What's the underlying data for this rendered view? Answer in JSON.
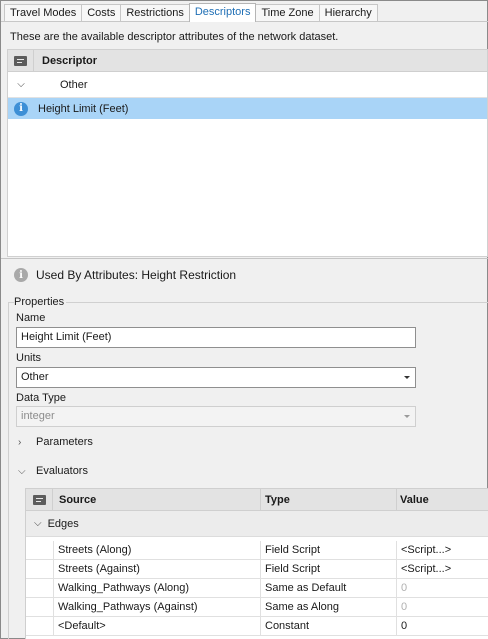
{
  "tabs": [
    {
      "label": "Travel Modes",
      "active": false
    },
    {
      "label": "Costs",
      "active": false
    },
    {
      "label": "Restrictions",
      "active": false
    },
    {
      "label": "Descriptors",
      "active": true
    },
    {
      "label": "Time Zone",
      "active": false
    },
    {
      "label": "Hierarchy",
      "active": false
    }
  ],
  "description": "These are the available descriptor attributes of the network dataset.",
  "descriptor_grid": {
    "header": "Descriptor",
    "group": "Other",
    "selected_item": "Height Limit (Feet)"
  },
  "used_by": "Used By Attributes: Height Restriction",
  "properties": {
    "legend": "Properties",
    "name_label": "Name",
    "name_value": "Height Limit (Feet)",
    "units_label": "Units",
    "units_value": "Other",
    "datatype_label": "Data Type",
    "datatype_value": "integer",
    "parameters_label": "Parameters",
    "evaluators_label": "Evaluators"
  },
  "evaluators_grid": {
    "columns": [
      "Source",
      "Type",
      "Value"
    ],
    "group": "Edges",
    "rows": [
      {
        "source": "Streets (Along)",
        "type": "Field Script",
        "value": "<Script...>"
      },
      {
        "source": "Streets (Against)",
        "type": "Field Script",
        "value": "<Script...>"
      },
      {
        "source": "Walking_Pathways (Along)",
        "type": "Same as Default",
        "value": "0"
      },
      {
        "source": "Walking_Pathways (Against)",
        "type": "Same as Along",
        "value": "0"
      },
      {
        "source": "<Default>",
        "type": "Constant",
        "value": "0"
      }
    ]
  },
  "icons": {
    "comment": "comment-icon",
    "info": "info-icon",
    "chevron_down": "chevron-down-icon",
    "chevron_right": "chevron-right-icon"
  },
  "colors": {
    "active_tab_text": "#1f6fb5",
    "selection": "#a9d4f7",
    "info_icon": "#3d8fd6"
  }
}
